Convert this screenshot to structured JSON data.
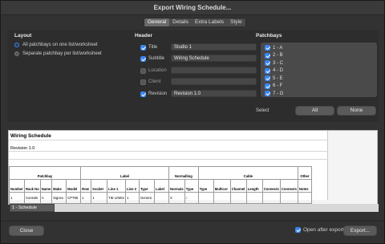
{
  "window": {
    "title": "Export Wiring Schedule..."
  },
  "tabs": [
    {
      "label": "General",
      "active": true
    },
    {
      "label": "Details",
      "active": false
    },
    {
      "label": "Extra Labels",
      "active": false
    },
    {
      "label": "Style",
      "active": false
    }
  ],
  "layout": {
    "title": "Layout",
    "options": [
      {
        "label": "All patchbays on one list/worksheet",
        "selected": true
      },
      {
        "label": "Separate patchbay per list/worksheet",
        "selected": false
      }
    ]
  },
  "header": {
    "title": "Header",
    "rows": [
      {
        "label": "Title",
        "checked": true,
        "value": "Studio 1"
      },
      {
        "label": "Subtitle",
        "checked": true,
        "value": "Wiring Schedule"
      },
      {
        "label": "Location",
        "checked": false,
        "value": ""
      },
      {
        "label": "Client",
        "checked": false,
        "value": ""
      },
      {
        "label": "Revision",
        "checked": true,
        "value": "Revision 1.0"
      }
    ]
  },
  "patchbays": {
    "title": "Patchbays",
    "items": [
      {
        "label": "1 - A",
        "checked": true
      },
      {
        "label": "2 - B",
        "checked": true
      },
      {
        "label": "3 - C",
        "checked": true
      },
      {
        "label": "4 - D",
        "checked": true
      },
      {
        "label": "5 - E",
        "checked": true
      },
      {
        "label": "6 - F",
        "checked": true
      },
      {
        "label": "7 - G",
        "checked": true
      }
    ],
    "select_label": "Select",
    "all_button": "All",
    "none_button": "None"
  },
  "preview": {
    "sheet_title": "Wiring Schedule",
    "revision": "Revision 1.0",
    "groups": [
      "Patchbay",
      "Label",
      "Normalling",
      "Cable",
      "Other"
    ],
    "columns": [
      "Number",
      "Rack No",
      "Name",
      "Make",
      "Model",
      "Row",
      "Socket",
      "Line 1",
      "Line 2",
      "Type",
      "Label",
      "Normals",
      "Type",
      "Type",
      "Multicor",
      "Channel",
      "Length",
      "Connects",
      "Connects",
      "Notes"
    ],
    "row": [
      "1",
      "Console",
      "A",
      "Signex",
      "CPT86",
      "1",
      "1",
      "TIE LINES",
      "1",
      "Generic",
      "",
      "X",
      "↕",
      "",
      "",
      "",
      "",
      "",
      "",
      ""
    ],
    "sheet_tab": "1 - Schedule"
  },
  "footer": {
    "close_button": "Close",
    "open_after_label": "Open after export",
    "open_after_checked": true,
    "export_button": "Export..."
  },
  "colors": {
    "accent": "#3a86f0",
    "window_bg": "#323232",
    "panel_bg": "#2d2d2d"
  }
}
